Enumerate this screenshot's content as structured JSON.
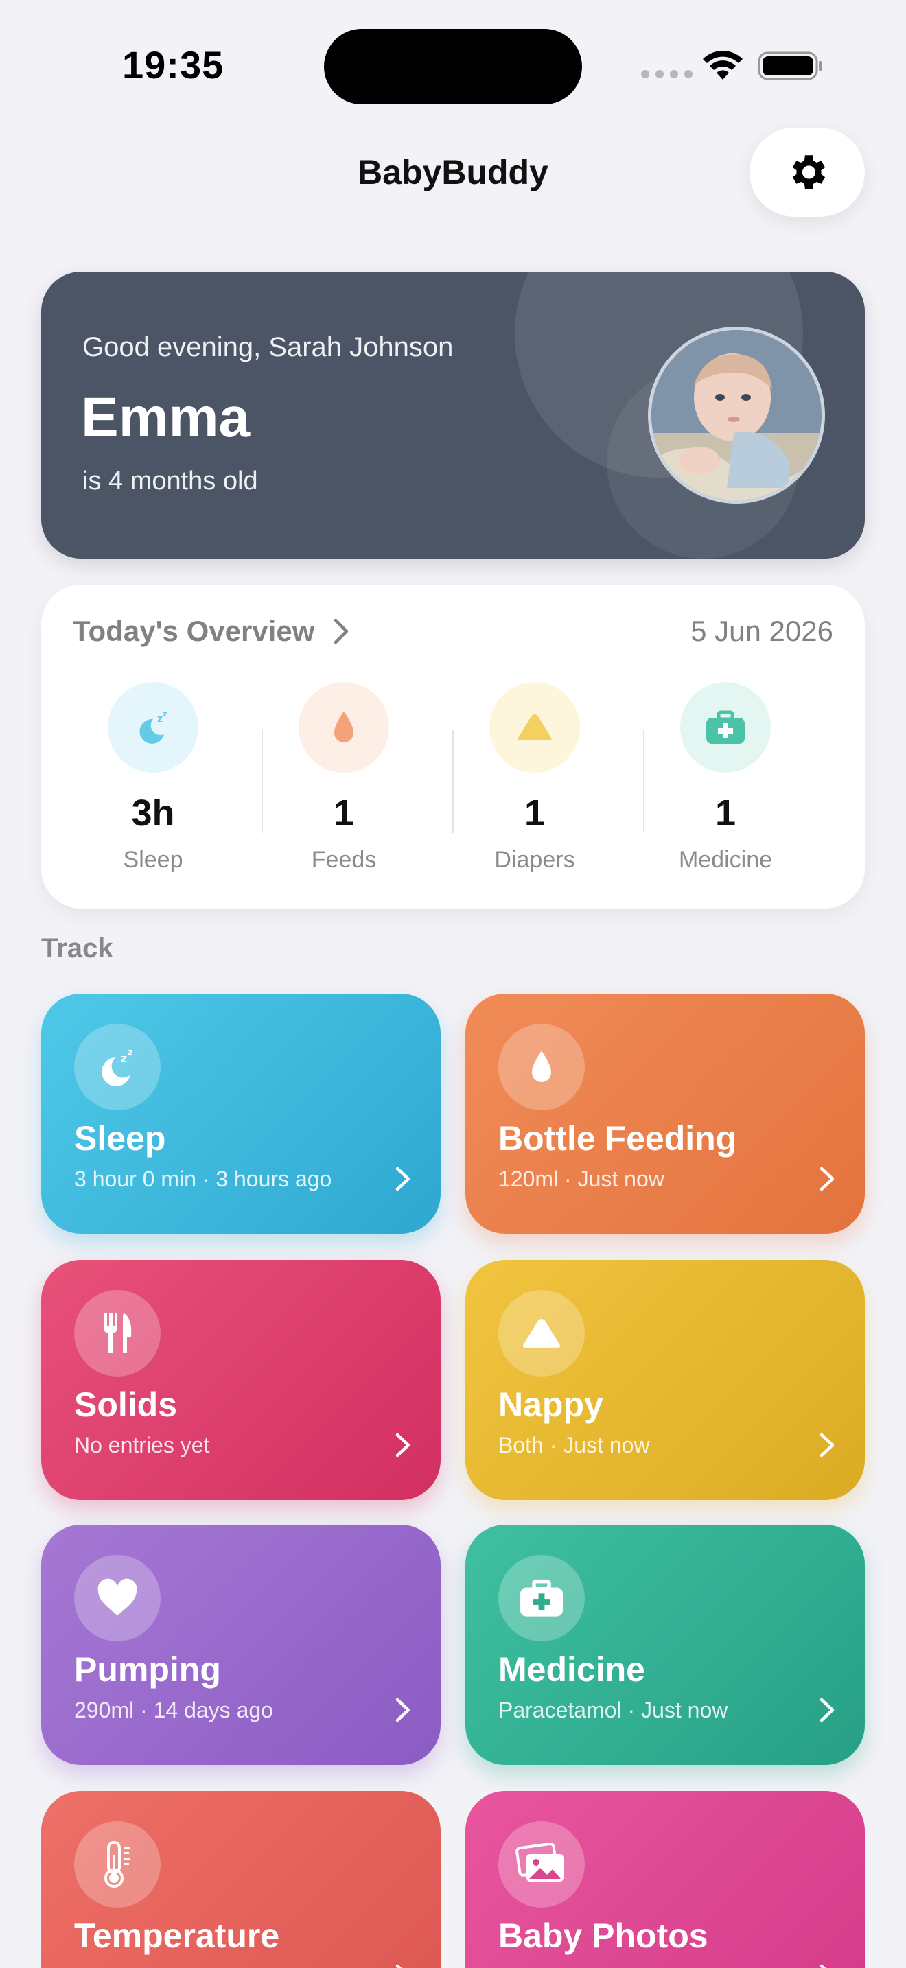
{
  "status_bar": {
    "time": "19:35"
  },
  "nav": {
    "title": "BabyBuddy",
    "settings_icon": "gear-icon"
  },
  "hero": {
    "greeting": "Good evening, Sarah Johnson",
    "baby_name": "Emma",
    "age_text": "is 4 months old",
    "background_color": "#4b5565"
  },
  "overview": {
    "title": "Today's Overview",
    "date": "5 Jun 2026",
    "stats": [
      {
        "value": "3h",
        "label": "Sleep",
        "icon": "sleep-moon-icon",
        "color": "#63cbe8"
      },
      {
        "value": "1",
        "label": "Feeds",
        "icon": "drop-icon",
        "color": "#f3a27c"
      },
      {
        "value": "1",
        "label": "Diapers",
        "icon": "triangle-icon",
        "color": "#f3d060"
      },
      {
        "value": "1",
        "label": "Medicine",
        "icon": "medkit-icon",
        "color": "#4cc3a6"
      }
    ]
  },
  "track": {
    "label": "Track",
    "cards": [
      {
        "title": "Sleep",
        "subtitle": "3 hour 0 min · 3 hours ago",
        "icon": "sleep-moon-icon"
      },
      {
        "title": "Bottle Feeding",
        "subtitle": "120ml · Just now",
        "icon": "drop-icon"
      },
      {
        "title": "Solids",
        "subtitle": "No entries yet",
        "icon": "fork-knife-icon"
      },
      {
        "title": "Nappy",
        "subtitle": "Both · Just now",
        "icon": "triangle-icon"
      },
      {
        "title": "Pumping",
        "subtitle": "290ml · 14 days ago",
        "icon": "heart-icon"
      },
      {
        "title": "Medicine",
        "subtitle": "Paracetamol · Just now",
        "icon": "medkit-icon"
      },
      {
        "title": "Temperature",
        "subtitle": "",
        "icon": "thermometer-icon"
      },
      {
        "title": "Baby Photos",
        "subtitle": "",
        "icon": "photos-icon"
      }
    ]
  }
}
